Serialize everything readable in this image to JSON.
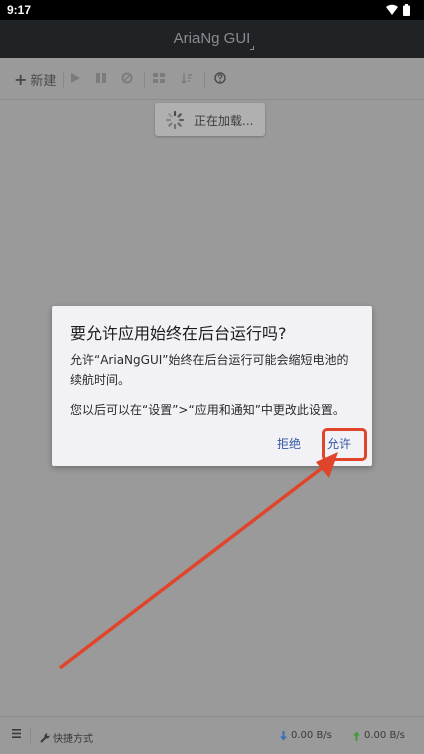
{
  "status_bar": {
    "time": "9:17"
  },
  "app": {
    "title": "AriaNg GUI"
  },
  "toolbar": {
    "new_label": "新建"
  },
  "loading": {
    "text": "正在加载..."
  },
  "dialog": {
    "title": "要允许应用始终在后台运行吗?",
    "message1": "允许“AriaNgGUI”始终在后台运行可能会缩短电池的续航时间。",
    "message2": "您以后可以在“设置”>“应用和通知”中更改此设置。",
    "deny_label": "拒绝",
    "allow_label": "允许"
  },
  "bottom_bar": {
    "shortcut_label": "快捷方式",
    "download_speed": "0.00 B/s",
    "upload_speed": "0.00 B/s"
  },
  "colors": {
    "annotation": "#e0452b",
    "dialog_button": "#3556a6",
    "download_arrow": "#3a6fb8",
    "upload_arrow": "#3f9a3a"
  }
}
